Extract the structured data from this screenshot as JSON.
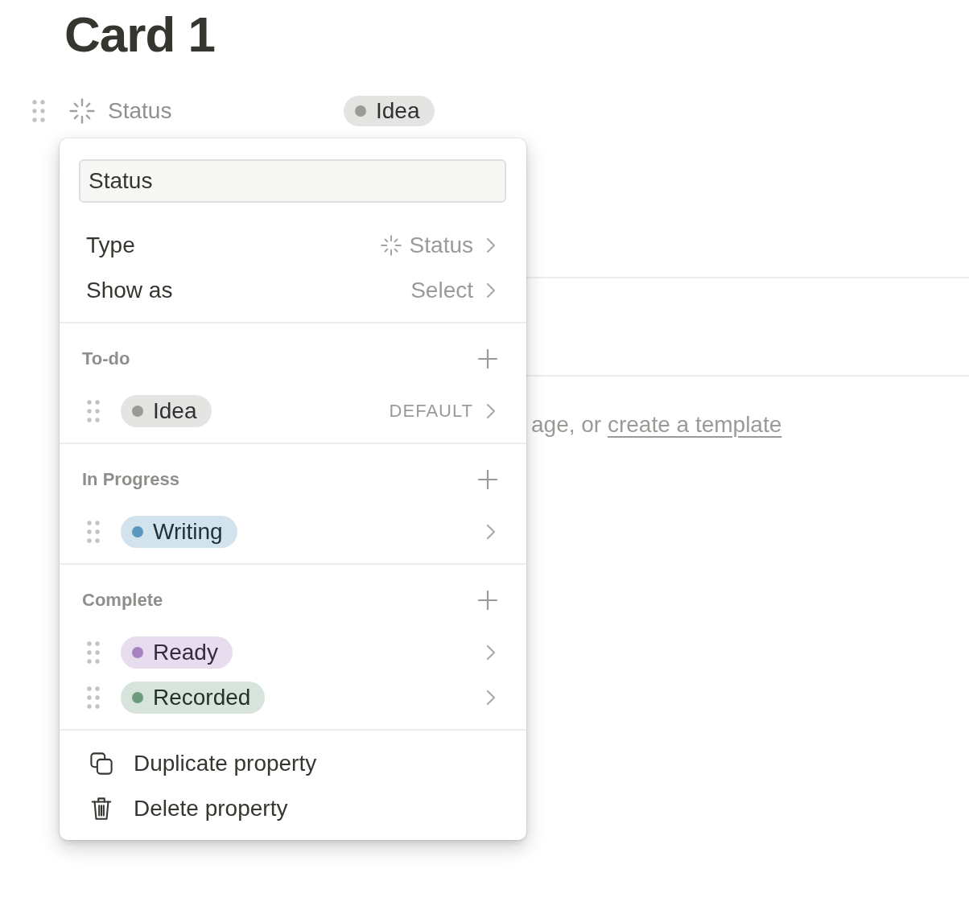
{
  "page": {
    "title": "Card 1",
    "property": {
      "label": "Status",
      "value": {
        "label": "Idea",
        "color": "#9b9a97"
      }
    },
    "hint": {
      "text": "age, or",
      "link": "create a template"
    }
  },
  "property_menu": {
    "name_field": {
      "value": "Status"
    },
    "settings": [
      {
        "kind": "icon",
        "label": "Type",
        "value": "Status"
      },
      {
        "kind": "text",
        "label": "Show as",
        "value": "Select"
      }
    ],
    "groups": [
      {
        "label": "To-do",
        "options": [
          {
            "label": "Idea",
            "color": "#9b9a97",
            "note": "DEFAULT"
          }
        ]
      },
      {
        "label": "In Progress",
        "options": [
          {
            "label": "Writing",
            "color": "#5b97bd"
          }
        ]
      },
      {
        "label": "Complete",
        "options": [
          {
            "label": "Ready",
            "color": "#a782c3"
          },
          {
            "label": "Recorded",
            "color": "#6c9b7d"
          }
        ]
      }
    ],
    "actions": [
      {
        "kind": "duplicate",
        "label": "Duplicate property"
      },
      {
        "kind": "delete",
        "label": "Delete property"
      }
    ]
  }
}
